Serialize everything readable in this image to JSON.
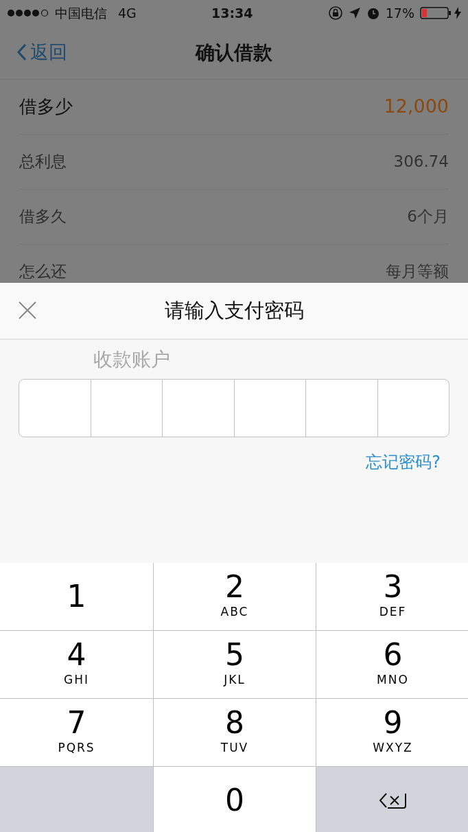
{
  "status_bar": {
    "carrier": "中国电信",
    "network": "4G",
    "time": "13:34",
    "battery_text": "17%"
  },
  "nav": {
    "back": "返回",
    "title": "确认借款"
  },
  "details": [
    {
      "label": "借多少",
      "value": "12,000",
      "kind": "amount"
    },
    {
      "label": "总利息",
      "value": "306.74",
      "kind": "plain"
    },
    {
      "label": "借多久",
      "value": "6个月",
      "kind": "plain"
    },
    {
      "label": "怎么还",
      "value": "每月等额",
      "kind": "plain"
    }
  ],
  "sheet": {
    "title": "请输入支付密码",
    "behind_text": "收款账户",
    "password_cells": [
      {
        "filled": false
      },
      {
        "filled": false
      },
      {
        "filled": false
      },
      {
        "filled": false
      },
      {
        "filled": false
      },
      {
        "filled": false
      }
    ],
    "forgot_link": "忘记密码?"
  },
  "keypad": [
    {
      "kind": "digit",
      "digit": "1"
    },
    {
      "kind": "digit",
      "digit": "2",
      "letters": "ABC"
    },
    {
      "kind": "digit",
      "digit": "3",
      "letters": "DEF"
    },
    {
      "kind": "digit",
      "digit": "4",
      "letters": "GHI"
    },
    {
      "kind": "digit",
      "digit": "5",
      "letters": "JKL"
    },
    {
      "kind": "digit",
      "digit": "6",
      "letters": "MNO"
    },
    {
      "kind": "digit",
      "digit": "7",
      "letters": "PQRS"
    },
    {
      "kind": "digit",
      "digit": "8",
      "letters": "TUV"
    },
    {
      "kind": "digit",
      "digit": "9",
      "letters": "WXYZ"
    },
    {
      "kind": "blank"
    },
    {
      "kind": "digit",
      "digit": "0"
    },
    {
      "kind": "backspace"
    }
  ]
}
